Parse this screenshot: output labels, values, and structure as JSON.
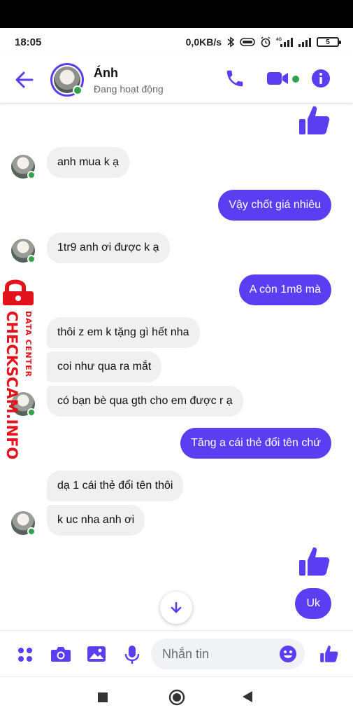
{
  "status_bar": {
    "time": "18:05",
    "network_speed": "0,0KB/s",
    "network_type": "4G",
    "battery_level": "5",
    "icons": [
      "bluetooth-icon",
      "vpn-key-icon",
      "alarm-icon",
      "signal-icon",
      "battery-icon"
    ]
  },
  "header": {
    "contact_name": "Ánh",
    "contact_status": "Đang hoạt động",
    "icons": [
      "back-arrow-icon",
      "phone-icon",
      "video-camera-icon",
      "info-icon"
    ]
  },
  "colors": {
    "accent": "#5b3ef2",
    "incoming_bubble": "#f0f0f0",
    "online": "#31a24c",
    "watermark_red": "#e3131b"
  },
  "watermark": {
    "brand": "CHECKSCAM.INFO",
    "tagline": "DATA CENTER"
  },
  "messages": [
    {
      "side": "out",
      "type": "like"
    },
    {
      "side": "in",
      "text": "anh mua k ạ"
    },
    {
      "side": "out",
      "text": "Vậy chốt giá nhiêu"
    },
    {
      "side": "in",
      "text": "1tr9 anh ơi  được k ạ"
    },
    {
      "side": "out",
      "text": "A còn 1m8 mà"
    },
    {
      "side": "in",
      "text": "thôi z em k tặng gì hết nha"
    },
    {
      "side": "in",
      "text": "coi như qua ra mắt"
    },
    {
      "side": "in",
      "text": "có bạn bè qua gth cho em được r ạ"
    },
    {
      "side": "out",
      "text": "Tăng a cái thẻ đổi tên chứ"
    },
    {
      "side": "in",
      "text": "dạ 1 cái thẻ đổi tên thôi"
    },
    {
      "side": "in",
      "text": "k uc nha anh ơi"
    },
    {
      "side": "out",
      "type": "like"
    },
    {
      "side": "out",
      "text": "Uk"
    }
  ],
  "composer": {
    "placeholder": "Nhắn tin",
    "icons": [
      "apps-grid-icon",
      "camera-icon",
      "gallery-icon",
      "microphone-icon",
      "emoji-icon",
      "like-icon"
    ]
  },
  "nav_bar": {
    "icons": [
      "recents-square-icon",
      "home-circle-icon",
      "back-triangle-icon"
    ]
  }
}
